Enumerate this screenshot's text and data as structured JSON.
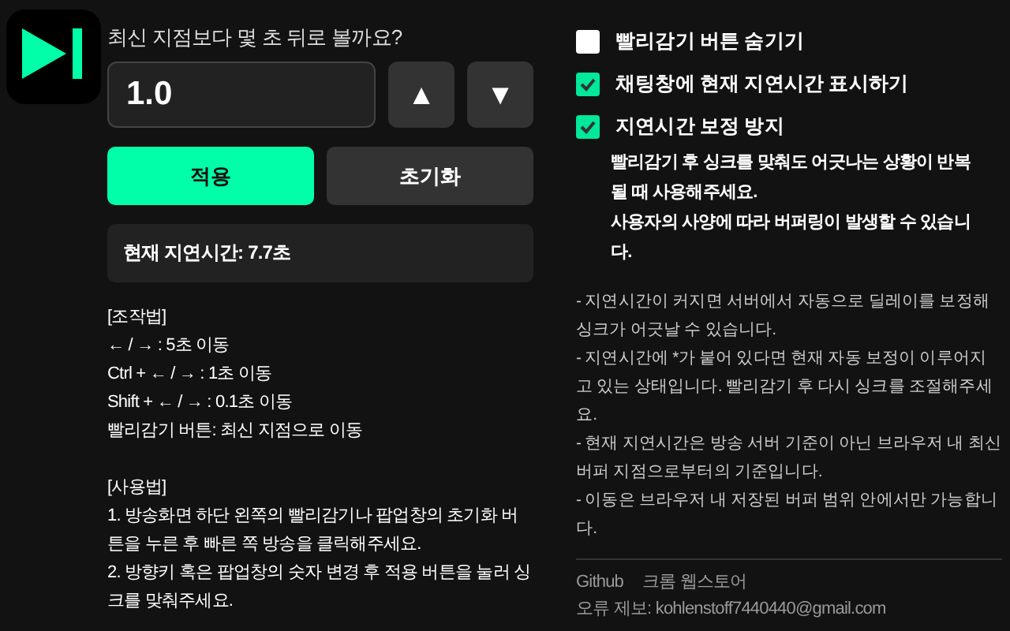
{
  "question": "최신 지점보다 몇 초 뒤로 볼까요?",
  "delay_input": {
    "value": "1.0"
  },
  "step_buttons": [
    {
      "label": "▲"
    },
    {
      "label": "▼"
    }
  ],
  "actions": [
    {
      "label": "적용",
      "kind": "primary"
    },
    {
      "label": "초기화",
      "kind": "secondary"
    }
  ],
  "current_delay": "현재 지연시간: 7.7초",
  "controls": {
    "heading": "[조작법]",
    "lines": [
      "← / → : 5초 이동",
      "Ctrl + ← / → : 1초 이동",
      "Shift + ← / → : 0.1초 이동",
      "빨리감기 버튼: 최신 지점으로 이동"
    ]
  },
  "usage": {
    "heading": "[사용법]",
    "lines": [
      "1. 방송화면 하단 왼쪽의 빨리감기나 팝업창의 초기화 버튼을 누른 후 빠른 쪽 방송을 클릭해주세요.",
      "2. 방향키 혹은 팝업창의 숫자 변경 후 적용 버튼을 눌러 싱크를 맞춰주세요."
    ]
  },
  "options": [
    {
      "label": "빨리감기 버튼 숨기기",
      "checked": false
    },
    {
      "label": "채팅창에 현재 지연시간 표시하기",
      "checked": true
    },
    {
      "label": "지연시간 보정 방지",
      "checked": true,
      "description": "빨리감기 후 싱크를 맞춰도 어긋나는 상황이 반복될 때 사용해주세요.\n사용자의 사양에 따라 버퍼링이 발생할 수 있습니다."
    }
  ],
  "notes": [
    "- 지연시간이 커지면 서버에서 자동으로 딜레이를 보정해 싱크가 어긋날 수 있습니다.",
    "- 지연시간에 *가 붙어 있다면 현재 자동 보정이 이루어지고 있는 상태입니다. 빨리감기 후 다시 싱크를 조절해주세요.",
    "- 현재 지연시간은 방송 서버 기준이 아닌 브라우저 내 최신 버퍼 지점으로부터의 기준입니다.",
    "- 이동은 브라우저 내 저장된 버퍼 범위 안에서만 가능합니다."
  ],
  "footer": {
    "links": [
      "Github",
      "크롬 웹스토어"
    ],
    "report": "오류 제보: kohlenstoff7440440@gmail.com"
  }
}
